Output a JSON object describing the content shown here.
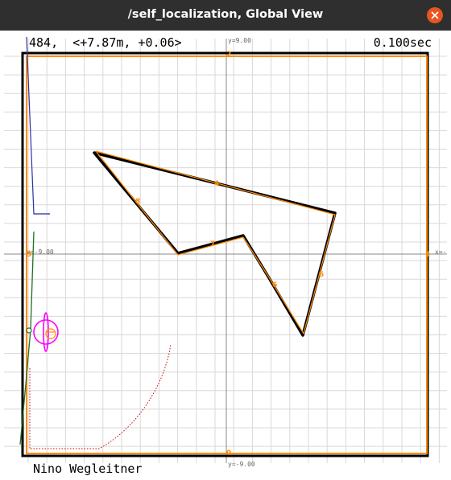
{
  "window": {
    "title": "/self_localization, Global View"
  },
  "hud": {
    "status": "484,  <+7.87m, +0.06>",
    "timing": "0.100sec",
    "author": "Nino Wegleitner"
  },
  "axes": {
    "y_top": "y=9.00",
    "y_bottom": "y=-9.00",
    "x_left": "x=-9.00",
    "x_right": "x=-"
  },
  "markers": {
    "top": "2",
    "bottom": "0",
    "left": "3",
    "right": "1",
    "e4": "4",
    "e5": "5",
    "e6": "6",
    "e7": "7",
    "e8": "8"
  },
  "colors": {
    "titlebar": "#2f2f2f",
    "close_button": "#e95420",
    "map_outline": "#ff8c00",
    "wall": "#000000",
    "grid": "#d8d8d8",
    "robot": "#ff00ff",
    "path_blue": "#3030a0",
    "path_green": "#207020",
    "path_red": "#cc0000"
  },
  "icons": {
    "close": "close-icon"
  }
}
